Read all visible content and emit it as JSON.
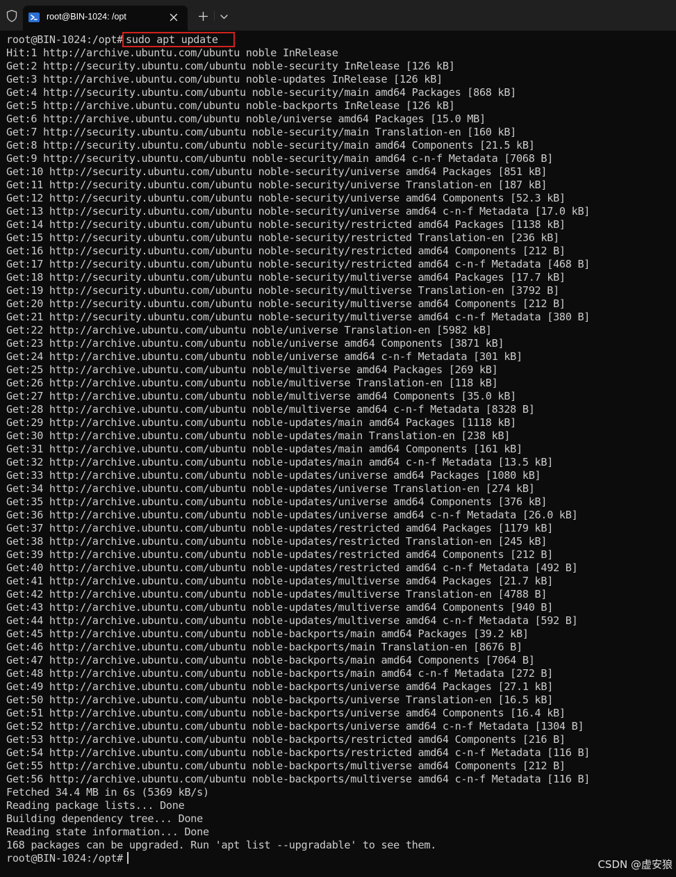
{
  "tab": {
    "title": "root@BIN-1024: /opt",
    "icon": "powershell-icon"
  },
  "colors": {
    "background": "#0c0c0c",
    "text": "#cccccc",
    "titlebar": "#202020",
    "highlight_box": "#d5211d"
  },
  "terminal": {
    "prompt": "root@BIN-1024:/opt#",
    "command": "sudo apt update",
    "output": [
      "Hit:1 http://archive.ubuntu.com/ubuntu noble InRelease",
      "Get:2 http://security.ubuntu.com/ubuntu noble-security InRelease [126 kB]",
      "Get:3 http://archive.ubuntu.com/ubuntu noble-updates InRelease [126 kB]",
      "Get:4 http://security.ubuntu.com/ubuntu noble-security/main amd64 Packages [868 kB]",
      "Get:5 http://archive.ubuntu.com/ubuntu noble-backports InRelease [126 kB]",
      "Get:6 http://archive.ubuntu.com/ubuntu noble/universe amd64 Packages [15.0 MB]",
      "Get:7 http://security.ubuntu.com/ubuntu noble-security/main Translation-en [160 kB]",
      "Get:8 http://security.ubuntu.com/ubuntu noble-security/main amd64 Components [21.5 kB]",
      "Get:9 http://security.ubuntu.com/ubuntu noble-security/main amd64 c-n-f Metadata [7068 B]",
      "Get:10 http://security.ubuntu.com/ubuntu noble-security/universe amd64 Packages [851 kB]",
      "Get:11 http://security.ubuntu.com/ubuntu noble-security/universe Translation-en [187 kB]",
      "Get:12 http://security.ubuntu.com/ubuntu noble-security/universe amd64 Components [52.3 kB]",
      "Get:13 http://security.ubuntu.com/ubuntu noble-security/universe amd64 c-n-f Metadata [17.0 kB]",
      "Get:14 http://security.ubuntu.com/ubuntu noble-security/restricted amd64 Packages [1138 kB]",
      "Get:15 http://security.ubuntu.com/ubuntu noble-security/restricted Translation-en [236 kB]",
      "Get:16 http://security.ubuntu.com/ubuntu noble-security/restricted amd64 Components [212 B]",
      "Get:17 http://security.ubuntu.com/ubuntu noble-security/restricted amd64 c-n-f Metadata [468 B]",
      "Get:18 http://security.ubuntu.com/ubuntu noble-security/multiverse amd64 Packages [17.7 kB]",
      "Get:19 http://security.ubuntu.com/ubuntu noble-security/multiverse Translation-en [3792 B]",
      "Get:20 http://security.ubuntu.com/ubuntu noble-security/multiverse amd64 Components [212 B]",
      "Get:21 http://security.ubuntu.com/ubuntu noble-security/multiverse amd64 c-n-f Metadata [380 B]",
      "Get:22 http://archive.ubuntu.com/ubuntu noble/universe Translation-en [5982 kB]",
      "Get:23 http://archive.ubuntu.com/ubuntu noble/universe amd64 Components [3871 kB]",
      "Get:24 http://archive.ubuntu.com/ubuntu noble/universe amd64 c-n-f Metadata [301 kB]",
      "Get:25 http://archive.ubuntu.com/ubuntu noble/multiverse amd64 Packages [269 kB]",
      "Get:26 http://archive.ubuntu.com/ubuntu noble/multiverse Translation-en [118 kB]",
      "Get:27 http://archive.ubuntu.com/ubuntu noble/multiverse amd64 Components [35.0 kB]",
      "Get:28 http://archive.ubuntu.com/ubuntu noble/multiverse amd64 c-n-f Metadata [8328 B]",
      "Get:29 http://archive.ubuntu.com/ubuntu noble-updates/main amd64 Packages [1118 kB]",
      "Get:30 http://archive.ubuntu.com/ubuntu noble-updates/main Translation-en [238 kB]",
      "Get:31 http://archive.ubuntu.com/ubuntu noble-updates/main amd64 Components [161 kB]",
      "Get:32 http://archive.ubuntu.com/ubuntu noble-updates/main amd64 c-n-f Metadata [13.5 kB]",
      "Get:33 http://archive.ubuntu.com/ubuntu noble-updates/universe amd64 Packages [1080 kB]",
      "Get:34 http://archive.ubuntu.com/ubuntu noble-updates/universe Translation-en [274 kB]",
      "Get:35 http://archive.ubuntu.com/ubuntu noble-updates/universe amd64 Components [376 kB]",
      "Get:36 http://archive.ubuntu.com/ubuntu noble-updates/universe amd64 c-n-f Metadata [26.0 kB]",
      "Get:37 http://archive.ubuntu.com/ubuntu noble-updates/restricted amd64 Packages [1179 kB]",
      "Get:38 http://archive.ubuntu.com/ubuntu noble-updates/restricted Translation-en [245 kB]",
      "Get:39 http://archive.ubuntu.com/ubuntu noble-updates/restricted amd64 Components [212 B]",
      "Get:40 http://archive.ubuntu.com/ubuntu noble-updates/restricted amd64 c-n-f Metadata [492 B]",
      "Get:41 http://archive.ubuntu.com/ubuntu noble-updates/multiverse amd64 Packages [21.7 kB]",
      "Get:42 http://archive.ubuntu.com/ubuntu noble-updates/multiverse Translation-en [4788 B]",
      "Get:43 http://archive.ubuntu.com/ubuntu noble-updates/multiverse amd64 Components [940 B]",
      "Get:44 http://archive.ubuntu.com/ubuntu noble-updates/multiverse amd64 c-n-f Metadata [592 B]",
      "Get:45 http://archive.ubuntu.com/ubuntu noble-backports/main amd64 Packages [39.2 kB]",
      "Get:46 http://archive.ubuntu.com/ubuntu noble-backports/main Translation-en [8676 B]",
      "Get:47 http://archive.ubuntu.com/ubuntu noble-backports/main amd64 Components [7064 B]",
      "Get:48 http://archive.ubuntu.com/ubuntu noble-backports/main amd64 c-n-f Metadata [272 B]",
      "Get:49 http://archive.ubuntu.com/ubuntu noble-backports/universe amd64 Packages [27.1 kB]",
      "Get:50 http://archive.ubuntu.com/ubuntu noble-backports/universe Translation-en [16.5 kB]",
      "Get:51 http://archive.ubuntu.com/ubuntu noble-backports/universe amd64 Components [16.4 kB]",
      "Get:52 http://archive.ubuntu.com/ubuntu noble-backports/universe amd64 c-n-f Metadata [1304 B]",
      "Get:53 http://archive.ubuntu.com/ubuntu noble-backports/restricted amd64 Components [216 B]",
      "Get:54 http://archive.ubuntu.com/ubuntu noble-backports/restricted amd64 c-n-f Metadata [116 B]",
      "Get:55 http://archive.ubuntu.com/ubuntu noble-backports/multiverse amd64 Components [212 B]",
      "Get:56 http://archive.ubuntu.com/ubuntu noble-backports/multiverse amd64 c-n-f Metadata [116 B]",
      "Fetched 34.4 MB in 6s (5369 kB/s)",
      "Reading package lists... Done",
      "Building dependency tree... Done",
      "Reading state information... Done",
      "168 packages can be upgraded. Run 'apt list --upgradable' to see them."
    ],
    "final_prompt": "root@BIN-1024:/opt#"
  },
  "watermark": "CSDN @虚安狼",
  "icons": {
    "shield": "shield-icon",
    "close": "close-icon",
    "new_tab": "plus-icon",
    "dropdown": "chevron-down-icon"
  }
}
